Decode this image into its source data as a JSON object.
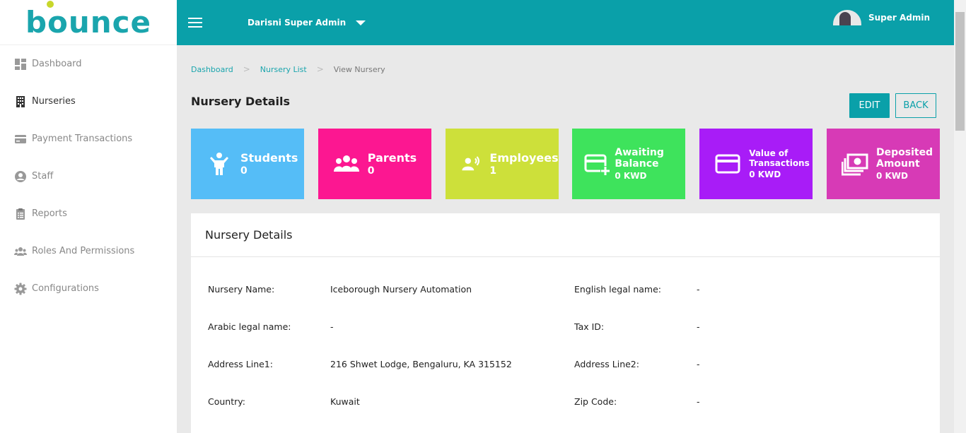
{
  "brand": {
    "logo_text": "bounce",
    "accent": "#0aa0a9",
    "logo_dot": "#c8d72b"
  },
  "sidebar": {
    "items": [
      {
        "label": "Dashboard",
        "icon": "dashboard-icon",
        "active": false
      },
      {
        "label": "Nurseries",
        "icon": "building-icon",
        "active": true
      },
      {
        "label": "Payment Transactions",
        "icon": "credit-card-icon",
        "active": false
      },
      {
        "label": "Staff",
        "icon": "user-circle-icon",
        "active": false
      },
      {
        "label": "Reports",
        "icon": "clipboard-icon",
        "active": false
      },
      {
        "label": "Roles And Permissions",
        "icon": "users-icon",
        "active": false
      },
      {
        "label": "Configurations",
        "icon": "gear-icon",
        "active": false
      }
    ]
  },
  "header": {
    "org_name": "Darisni Super Admin",
    "user_name": "Super Admin"
  },
  "breadcrumb": {
    "items": [
      "Dashboard",
      "Nursery List"
    ],
    "current": "View Nursery"
  },
  "page": {
    "title": "Nursery Details",
    "edit_label": "EDIT",
    "back_label": "BACK"
  },
  "cards": [
    {
      "label": "Students",
      "value": "0",
      "color": "#55bdf7",
      "icon": "child-icon"
    },
    {
      "label": "Parents",
      "value": "0",
      "color": "#fc1791",
      "icon": "group-icon"
    },
    {
      "label": "Employees",
      "value": "1",
      "color": "#cde03a",
      "icon": "employee-icon"
    },
    {
      "label": "Awaiting Balance",
      "value": "0 KWD",
      "color": "#3ee35c",
      "icon": "card-plus-icon"
    },
    {
      "label": "Value of Transactions",
      "value": "0 KWD",
      "color": "#a81cf7",
      "icon": "credit-card-icon"
    },
    {
      "label": "Deposited Amount",
      "value": "0 KWD",
      "color": "#d73ab6",
      "icon": "money-icon"
    }
  ],
  "details": {
    "panel_title": "Nursery Details",
    "rows": [
      {
        "label": "Nursery Name:",
        "value": "Iceborough Nursery Automation",
        "label2": "English legal name:",
        "value2": "-"
      },
      {
        "label": "Arabic legal name:",
        "value": "-",
        "label2": "Tax ID:",
        "value2": "-"
      },
      {
        "label": "Address Line1:",
        "value": "216 Shwet Lodge, Bengaluru, KA 315152",
        "label2": "Address Line2:",
        "value2": "-"
      },
      {
        "label": "Country:",
        "value": "Kuwait",
        "label2": "Zip Code:",
        "value2": "-"
      }
    ]
  }
}
